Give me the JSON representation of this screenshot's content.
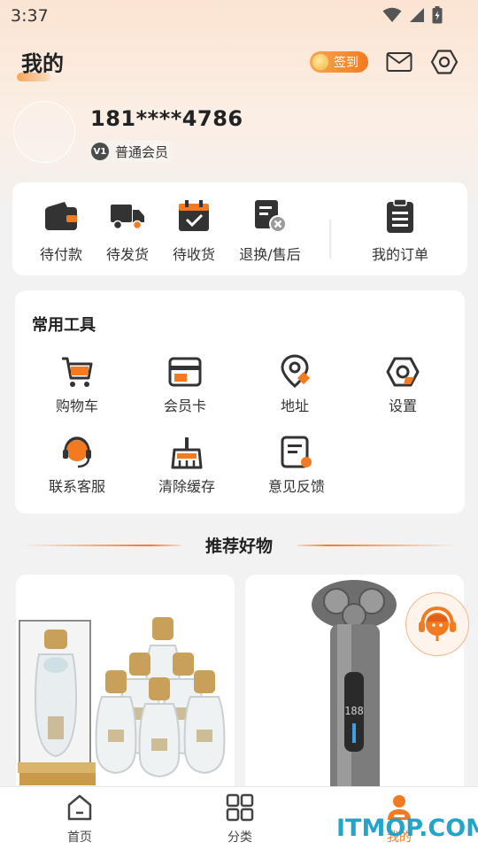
{
  "status_bar": {
    "time": "3:37"
  },
  "header": {
    "title": "我的",
    "signin_label": "签到"
  },
  "profile": {
    "phone": "181****4786",
    "level": "V1",
    "member_type": "普通会员"
  },
  "orders": {
    "items": [
      {
        "label": "待付款",
        "icon": "wallet-icon"
      },
      {
        "label": "待发货",
        "icon": "truck-icon"
      },
      {
        "label": "待收货",
        "icon": "calendar-check-icon"
      },
      {
        "label": "退换/售后",
        "icon": "return-document-icon"
      }
    ],
    "all_orders_label": "我的订单"
  },
  "tools": {
    "title": "常用工具",
    "items": [
      {
        "label": "购物车",
        "icon": "cart-icon"
      },
      {
        "label": "会员卡",
        "icon": "card-icon"
      },
      {
        "label": "地址",
        "icon": "location-icon"
      },
      {
        "label": "设置",
        "icon": "settings-icon"
      },
      {
        "label": "联系客服",
        "icon": "customer-service-icon"
      },
      {
        "label": "清除缓存",
        "icon": "broom-icon"
      },
      {
        "label": "意见反馈",
        "icon": "feedback-icon"
      }
    ]
  },
  "recommend": {
    "title": "推荐好物"
  },
  "bottom_nav": {
    "items": [
      {
        "label": "首页",
        "icon": "home-icon"
      },
      {
        "label": "分类",
        "icon": "category-icon"
      },
      {
        "label": "我的",
        "icon": "profile-icon"
      }
    ],
    "active_index": 2
  },
  "watermark": {
    "text": "ITMOP.COM"
  },
  "colors": {
    "accent": "#f27a20",
    "icon_dark": "#333333"
  }
}
